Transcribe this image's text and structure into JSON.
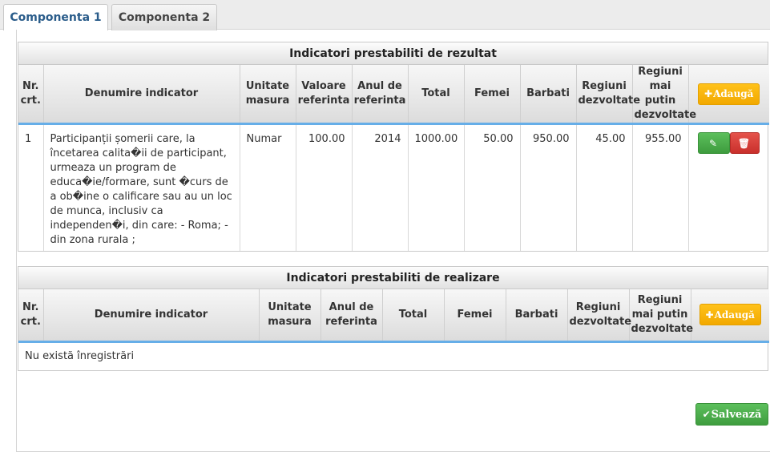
{
  "tabs": [
    {
      "label": "Componenta 1",
      "active": true
    },
    {
      "label": "Componenta 2",
      "active": false
    }
  ],
  "result_indicators": {
    "caption": "Indicatori prestabiliti de rezultat",
    "headers": {
      "nr": "Nr. crt.",
      "name": "Denumire indicator",
      "unit": "Unitate masura",
      "ref_value": "Valoare referinta",
      "ref_year": "Anul de referinta",
      "total": "Total",
      "women": "Femei",
      "men": "Barbati",
      "developed": "Regiuni dezvoltate",
      "less_developed": "Regiuni mai putin dezvoltate"
    },
    "add_label": "Adaugă",
    "rows": [
      {
        "nr": "1",
        "name": "Participanții șomerii care, la încetarea calita�ii de participant, urmeaza un program de educa�ie/formare, sunt �curs de a ob�ine o calificare sau au un loc de munca, inclusiv ca independen�i, din care: - Roma; - din zona rurala ;",
        "unit": "Numar",
        "ref_value": "100.00",
        "ref_year": "2014",
        "total": "1000.00",
        "women": "50.00",
        "men": "950.00",
        "developed": "45.00",
        "less_developed": "955.00"
      }
    ]
  },
  "realization_indicators": {
    "caption": "Indicatori prestabiliti de realizare",
    "headers": {
      "nr": "Nr. crt.",
      "name": "Denumire indicator",
      "unit": "Unitate masura",
      "ref_year": "Anul de referinta",
      "total": "Total",
      "women": "Femei",
      "men": "Barbati",
      "developed": "Regiuni dezvoltate",
      "less_developed": "Regiuni mai putin dezvoltate"
    },
    "add_label": "Adaugă",
    "empty_message": "Nu există înregistrări"
  },
  "save_label": "Salvează",
  "icons": {
    "plus": "plus-icon",
    "edit": "pencil-square-icon",
    "delete": "trash-icon",
    "check": "check-icon"
  },
  "colors": {
    "add": "#f2a900",
    "edit": "#47a447",
    "delete": "#d2322d",
    "save": "#47a447",
    "header_underline": "#66aee8"
  }
}
